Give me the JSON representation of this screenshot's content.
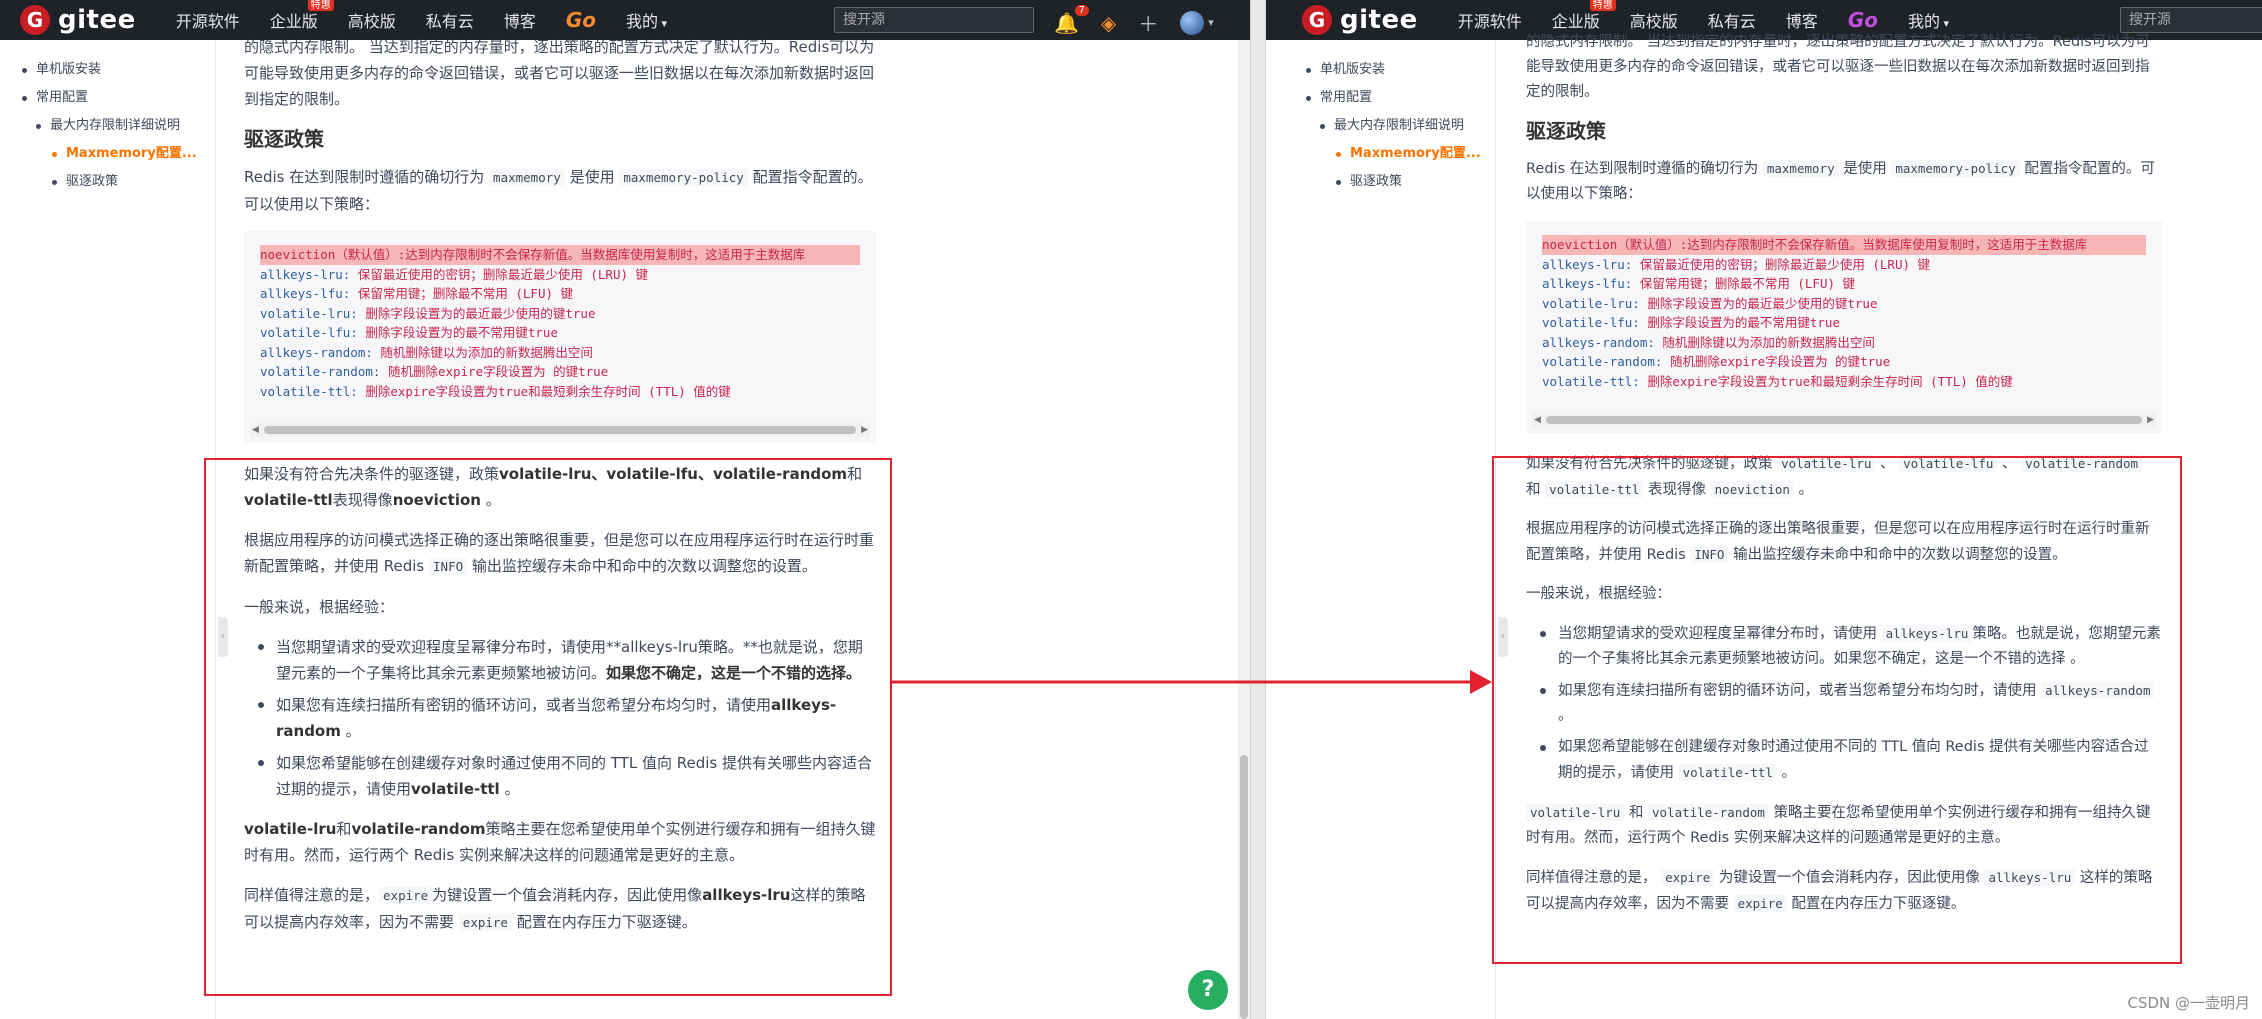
{
  "navbar": {
    "logo_letter": "G",
    "logo_text": "gitee",
    "items": [
      "开源软件",
      "企业版",
      "高校版",
      "私有云",
      "博客"
    ],
    "enterprise_badge": "特惠",
    "go_label": "Go",
    "mine_label": "我的",
    "search_placeholder": "搜开源",
    "notification_count": "7"
  },
  "toc": {
    "items": [
      {
        "label": "单机版安装",
        "level": 1
      },
      {
        "label": "常用配置",
        "level": 1
      },
      {
        "label": "最大内存限制详细说明",
        "level": 2
      },
      {
        "label": "Maxmemory配置...",
        "level": 3,
        "active": true
      },
      {
        "label": "驱逐政策",
        "level": 3
      }
    ]
  },
  "article": {
    "intro_left": "的隐式内存限制。 当达到指定的内存量时，逐出策略的配置方式决定了默认行为。Redis可以为可能导致使用更多内存的命令返回错误，或者它可以驱逐一些旧数据以在每次添加新数据时返回到指定的限制。",
    "intro_right": "的隐式内存限制。 当达到指定的内存量时，逐出策略的配置方式决定了默认行为。Redis可以为可能导致使用更多内存的命令返回错误，或者它可以驱逐一些旧数据以在每次添加新数据时返回到指定的限制。",
    "heading": "驱逐政策",
    "p1_a": "Redis 在达到限制时遵循的确切行为",
    "p1_code1": "maxmemory",
    "p1_b": "是使用",
    "p1_code2": "maxmemory-policy",
    "p1_c": "配置指令配置的。可以使用以下策略：",
    "code_lines": [
      {
        "key": "noeviction（默认值）:",
        "text": "达到内存限制时不会保存新值。当数据库使用复制时，这适用于主数据库",
        "highlight": true
      },
      {
        "key": "allkeys-lru:",
        "text": "保留最近使用的密钥；删除最近最少使用 (LRU) 键"
      },
      {
        "key": "allkeys-lfu:",
        "text": "保留常用键；删除最不常用 (LFU) 键"
      },
      {
        "key": "volatile-lru:",
        "text": "删除字段设置为的最近最少使用的键true"
      },
      {
        "key": "volatile-lfu:",
        "text": "删除字段设置为的最不常用键true"
      },
      {
        "key": "allkeys-random:",
        "text": "随机删除键以为添加的新数据腾出空间"
      },
      {
        "key": "volatile-random:",
        "text": "随机删除expire字段设置为 的键true"
      },
      {
        "key": "volatile-ttl:",
        "text": "删除expire字段设置为true和最短剩余生存时间 (TTL) 值的键"
      }
    ],
    "left": {
      "p2": "如果没有符合先决条件的驱逐键，政策",
      "p2_b": "volatile-lru、volatile-lfu、volatile-random",
      "p2_c": "和",
      "p2_d": "volatile-ttl",
      "p2_e": "表现得像",
      "p2_f": "noeviction",
      "p2_g": " 。",
      "p3_a": "根据应用程序的访问模式选择正确的逐出策略很重要，但是您可以在应用程序运行时在运行时重新配置策略，并使用 Redis",
      "p3_code": "INFO",
      "p3_b": "输出监控缓存未命中和命中的次数以调整您的设置。",
      "p4": "一般来说，根据经验：",
      "li1_a": "当您期望请求的受欢迎程度呈幂律分布时，请使用**allkeys-lru策略。**也就是说，您期望元素的一个子集将比其余元素更频繁地被访问。",
      "li1_b": "如果您不确定，这是一个不错的选择。",
      "li2_a": "如果您有连续扫描所有密钥的循环访问，或者当您希望分布均匀时，请使用",
      "li2_b": "allkeys-random",
      "li2_c": " 。",
      "li3_a": "如果您希望能够在创建缓存对象时通过使用不同的 TTL 值向 Redis 提供有关哪些内容适合过期的提示，请使用",
      "li3_b": "volatile-ttl",
      "li3_c": " 。",
      "p5_b": "volatile-lru",
      "p5_c": "和",
      "p5_d": "volatile-random",
      "p5_e": "策略主要在您希望使用单个实例进行缓存和拥有一组持久键时有用。然而，运行两个 Redis 实例来解决这样的问题通常是更好的主意。",
      "p6_a": "同样值得注意的是，",
      "p6_code": "expire",
      "p6_b": "为键设置一个值会消耗内存，因此使用像",
      "p6_c": "allkeys-lru",
      "p6_d": "这样的策略可以提高内存效率，因为不需要",
      "p6_code2": "expire",
      "p6_e": "配置在内存压力下驱逐键。"
    },
    "right": {
      "p2_a": "如果没有符合先决条件的驱逐键，政策",
      "c1": "volatile-lru",
      "sep1": " 、",
      "c2": "volatile-lfu",
      "sep2": " 、",
      "c3": "volatile-random",
      "and": "和",
      "c4": "volatile-ttl",
      "p2_b": "表现得像",
      "c5": "noeviction",
      "p2_c": " 。",
      "li1_a": "当您期望请求的受欢迎程度呈幂律分布时，请使用",
      "li1_code": "allkeys-lru",
      "li1_b": "策略。也就是说，您期望元素的一个子集将比其余元素更频繁地被访问。如果您不确定，这是一个不错的选择 。",
      "li2_code": "allkeys-random",
      "li3_code": "volatile-ttl",
      "p5_code1": "volatile-lru",
      "p5_code2": "volatile-random",
      "p6_code3": "allkeys-lru"
    }
  },
  "help_label": "?",
  "watermark": "CSDN @一壶明月"
}
